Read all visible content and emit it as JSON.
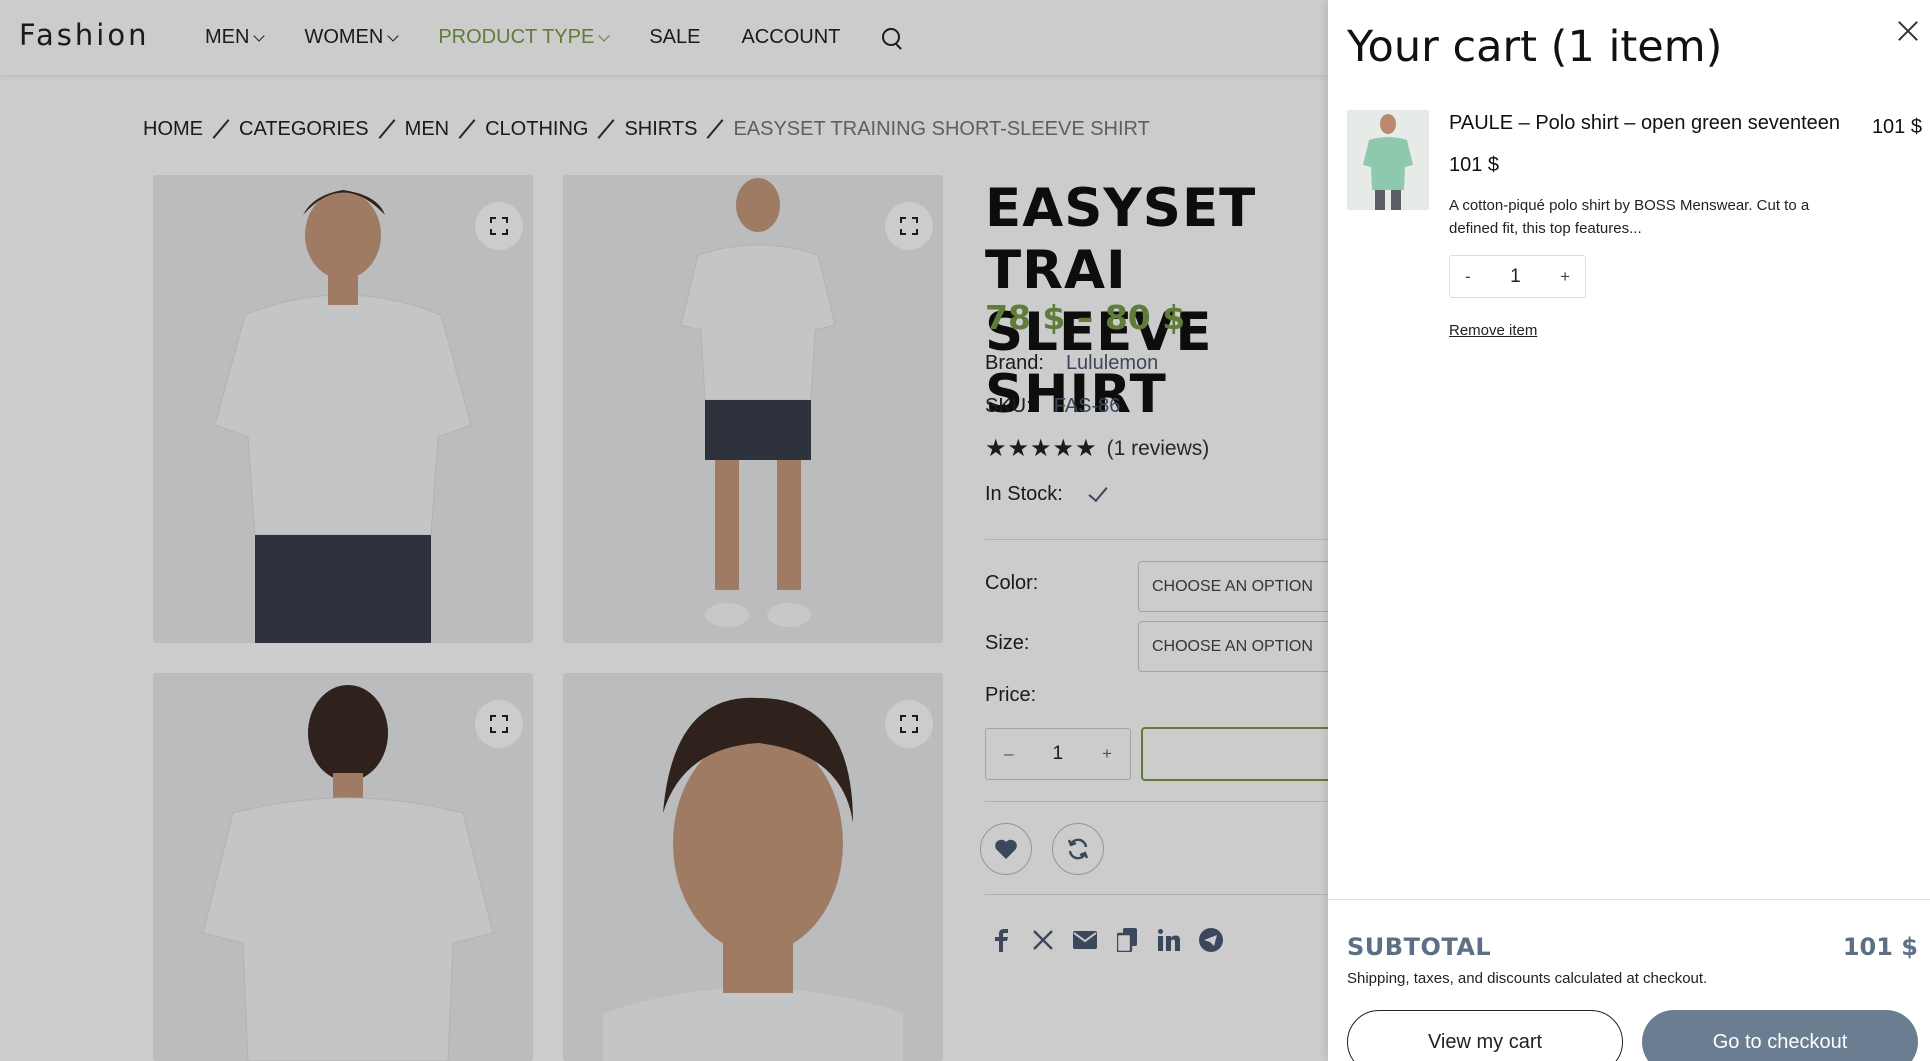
{
  "header": {
    "logo": "Fashion",
    "nav": [
      {
        "label": "MEN",
        "has_dropdown": true
      },
      {
        "label": "WOMEN",
        "has_dropdown": true
      },
      {
        "label": "PRODUCT TYPE",
        "has_dropdown": true,
        "active": true
      },
      {
        "label": "SALE",
        "has_dropdown": false
      },
      {
        "label": "ACCOUNT",
        "has_dropdown": false
      }
    ],
    "search_icon": "search-icon"
  },
  "breadcrumb": [
    "HOME",
    "CATEGORIES",
    "MEN",
    "CLOTHING",
    "SHIRTS",
    "EASYSET TRAINING SHORT-SLEEVE SHIRT"
  ],
  "product": {
    "title_line1": "EASYSET TRAI",
    "title_line2": "SLEEVE SHIRT",
    "price_range": "78 $ – 80 $",
    "brand_label": "Brand:",
    "brand": "Lululemon",
    "sku_label": "SKU:",
    "sku": "FAS-86",
    "rating": 5,
    "reviews": "(1 reviews)",
    "stock_label": "In Stock:",
    "color_label": "Color:",
    "color_placeholder": "CHOOSE AN OPTION",
    "size_label": "Size:",
    "size_placeholder": "CHOOSE AN OPTION",
    "price_label": "Price:",
    "qty_minus": "–",
    "qty": "1",
    "qty_plus": "+",
    "accent_color": "#7a9a4a"
  },
  "cart": {
    "title": "Your cart (1 item)",
    "item": {
      "name": "PAULE – Polo shirt – open green seventeen",
      "line_price": "101 $",
      "unit_price": "101 $",
      "description": "A cotton-piqué polo shirt by BOSS Menswear. Cut to a defined fit, this top features...",
      "qty_minus": "-",
      "qty": "1",
      "qty_plus": "+",
      "remove_label": "Remove item"
    },
    "subtotal_label": "SUBTOTAL",
    "subtotal_value": "101 $",
    "subtotal_note": "Shipping, taxes, and discounts calculated at checkout.",
    "view_cart_label": "View my cart",
    "checkout_label": "Go to checkout",
    "checkout_color": "#6a7d91"
  }
}
